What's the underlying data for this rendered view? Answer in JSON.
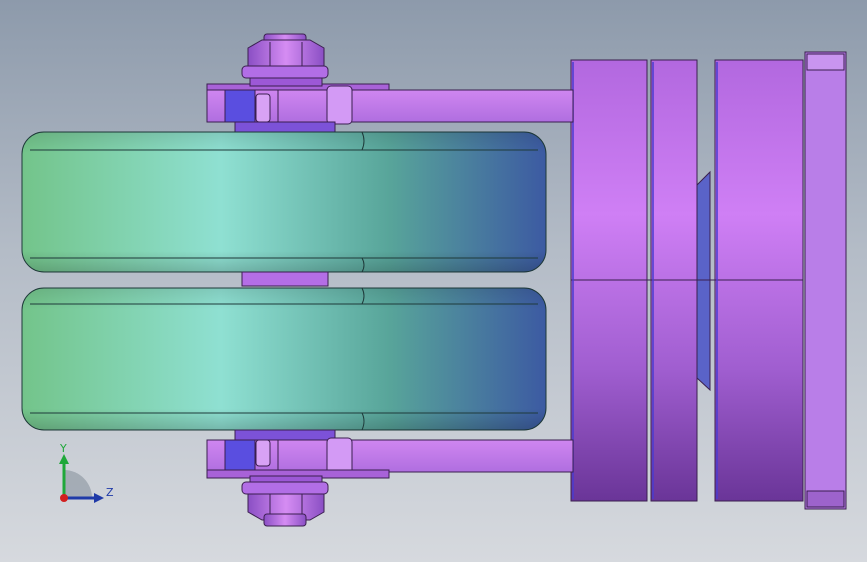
{
  "viewport": {
    "background_top": "#8d9aab",
    "background_bottom": "#d6d9de"
  },
  "model": {
    "wheel_color_left": "#6cc487",
    "wheel_color_highlight": "#8fe0d2",
    "wheel_color_right": "#3f5fa0",
    "bracket_color": "#c27be8",
    "bracket_dark": "#8a3fc0",
    "edge_color": "#3a1f4f"
  },
  "triad": {
    "y_label": "Y",
    "z_label": "Z",
    "y_color": "#1fa83a",
    "z_color": "#1f3aa8",
    "origin_color": "#d11f1f"
  }
}
